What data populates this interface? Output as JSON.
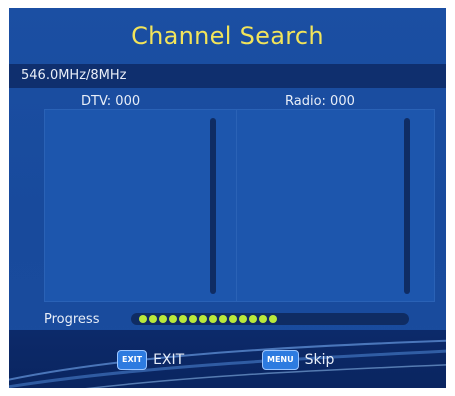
{
  "header": {
    "title": "Channel Search"
  },
  "status": {
    "frequency": "546.0MHz/8MHz"
  },
  "counts": {
    "dtv": "DTV: 000",
    "radio": "Radio: 000"
  },
  "progress": {
    "label": "Progress",
    "dots_filled": 14,
    "fraction": 0.5
  },
  "footer": {
    "exit_key": "EXIT",
    "exit_label": "EXIT",
    "menu_key": "MENU",
    "skip_label": "Skip"
  },
  "colors": {
    "background": "#1b4fa3",
    "title": "#f2e45a",
    "progress_dot": "#b9ea3c",
    "footer": "#0c2a6a"
  }
}
